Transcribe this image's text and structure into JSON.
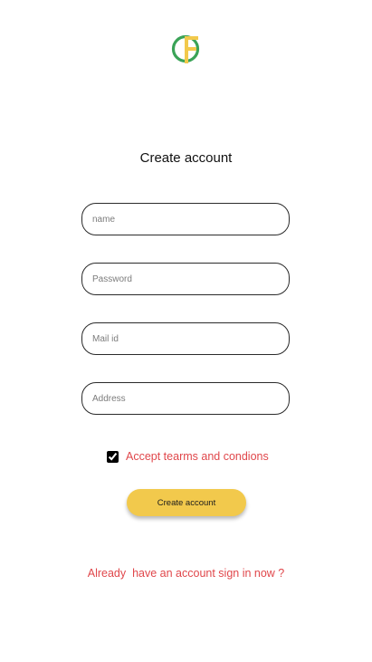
{
  "logo": {
    "icon": "letter-f-circle-logo",
    "colors": {
      "ring": "#3aa357",
      "letter": "#f2c94c"
    }
  },
  "header": {
    "title": "Create account"
  },
  "form": {
    "name_placeholder": "name",
    "password_placeholder": "Password",
    "mail_placeholder": "Mail id",
    "address_placeholder": "Address",
    "terms_checked": true,
    "terms_label": "Accept tearms and condions",
    "submit_label": "Create account"
  },
  "footer": {
    "signin_link": "Already  have an account sign in now ?"
  },
  "colors": {
    "accent": "#f2c94c",
    "link": "#e0474b",
    "border": "#2b2b2b"
  }
}
